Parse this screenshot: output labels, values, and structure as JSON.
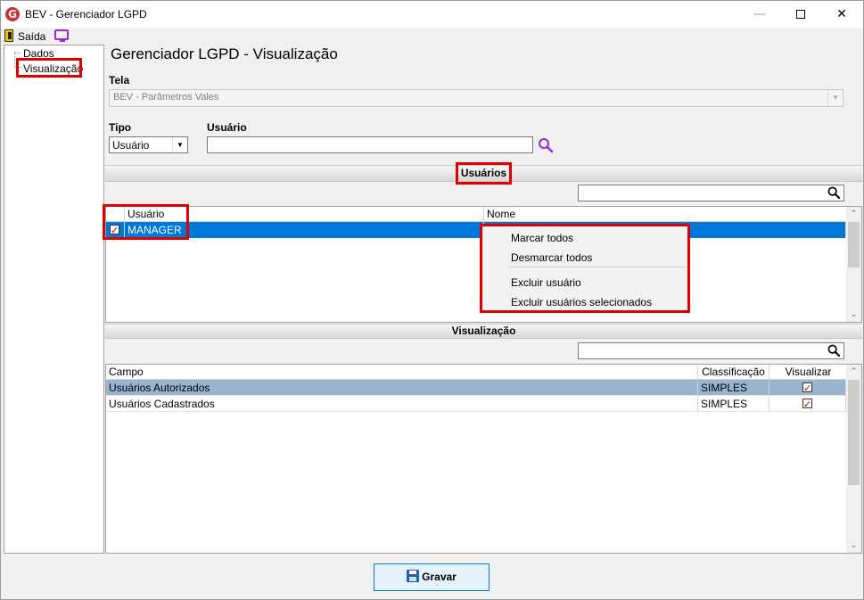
{
  "window": {
    "title": "BEV - Gerenciador LGPD",
    "logo_letter": "G"
  },
  "toolbar": {
    "exit_label": "Saída"
  },
  "tree": {
    "items": [
      "Dados",
      "Visualização"
    ]
  },
  "main": {
    "title": "Gerenciador LGPD - Visualização",
    "tela_label": "Tela",
    "tela_value": "BEV - Parâmetros Vales",
    "tipo_label": "Tipo",
    "tipo_value": "Usuário",
    "usuario_label": "Usuário",
    "usuario_value": ""
  },
  "usuarios_section": {
    "title": "Usuários",
    "columns": [
      "Usuário",
      "Nome"
    ],
    "rows": [
      {
        "usuario": "MANAGER",
        "nome": "",
        "checked": true
      }
    ]
  },
  "context_menu": {
    "items": [
      "Marcar todos",
      "Desmarcar todos",
      "Excluir usuário",
      "Excluir usuários selecionados"
    ]
  },
  "visualizacao_section": {
    "title": "Visualização",
    "columns": [
      "Campo",
      "Classificação",
      "Visualizar"
    ],
    "rows": [
      {
        "campo": "Usuários Autorizados",
        "classificacao": "SIMPLES",
        "visualizar": true
      },
      {
        "campo": "Usuários Cadastrados",
        "classificacao": "SIMPLES",
        "visualizar": true
      }
    ]
  },
  "footer": {
    "save_label": "Gravar"
  },
  "colors": {
    "highlight": "#e00000",
    "selection": "#0078d7",
    "selection_light": "#99b4d1",
    "accent": "#9b27d9"
  }
}
